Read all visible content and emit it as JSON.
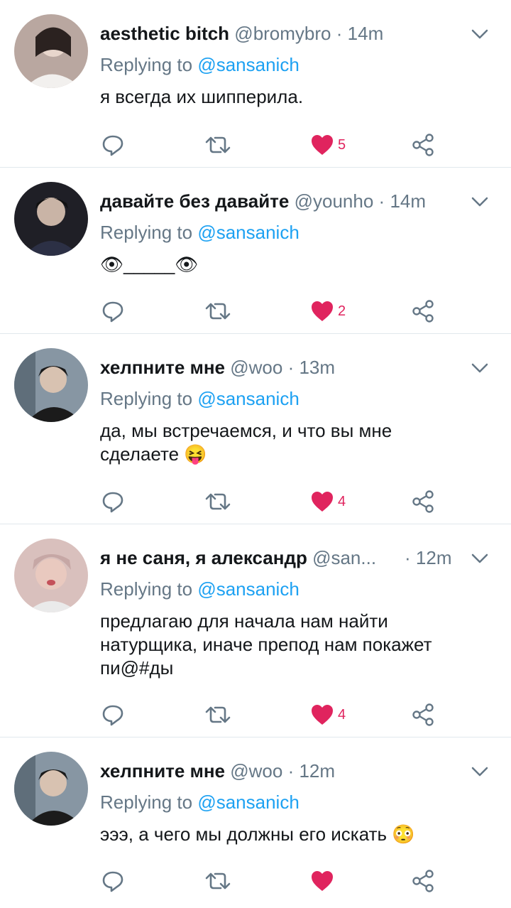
{
  "tweets": [
    {
      "name": "aesthetic bitch",
      "handle": "@bromybro",
      "separator": "·",
      "time": "14m",
      "replying_label": "Replying to",
      "replying_to": "@sansanich",
      "text_lines": [
        "я всегда их шипперила."
      ],
      "likes": "5",
      "liked": true,
      "avatar_color": "#b9a7a0"
    },
    {
      "name": "давайте без давайте",
      "handle": "@younho",
      "separator": "·",
      "time": "14m",
      "replying_label": "Replying to",
      "replying_to": "@sansanich",
      "text_lines": [
        "👁_____👁"
      ],
      "likes": "2",
      "liked": true,
      "avatar_color": "#2a2a33"
    },
    {
      "name": "хелпните мне",
      "handle": "@woo",
      "separator": "·",
      "time": "13m",
      "replying_label": "Replying to",
      "replying_to": "@sansanich",
      "text_lines": [
        "да, мы встречаемся, и что вы мне",
        "сделаете 😝"
      ],
      "likes": "4",
      "liked": true,
      "avatar_color": "#7a8a97"
    },
    {
      "name": "я не саня, я александр",
      "handle": "@san...",
      "separator": "·",
      "time": "12m",
      "replying_label": "Replying to",
      "replying_to": "@sansanich",
      "text_lines": [
        "предлагаю для начала нам найти",
        "натурщика, иначе препод нам покажет",
        "пи@#ды"
      ],
      "likes": "4",
      "liked": true,
      "avatar_color": "#c9a3a3"
    },
    {
      "name": "хелпните мне",
      "handle": "@woo",
      "separator": "·",
      "time": "12m",
      "replying_label": "Replying to",
      "replying_to": "@sansanich",
      "text_lines": [
        "эээ, а чего мы должны его искать 😳"
      ],
      "likes": "",
      "liked": true,
      "avatar_color": "#7a8a97"
    }
  ],
  "colors": {
    "name": "#14171a",
    "muted": "#657786",
    "mention": "#1da1f2",
    "like": "#e0245e",
    "divider": "#e1e8ed"
  },
  "icons": [
    "reply-icon",
    "retweet-icon",
    "heart-icon",
    "share-icon",
    "chevron-down-icon"
  ]
}
